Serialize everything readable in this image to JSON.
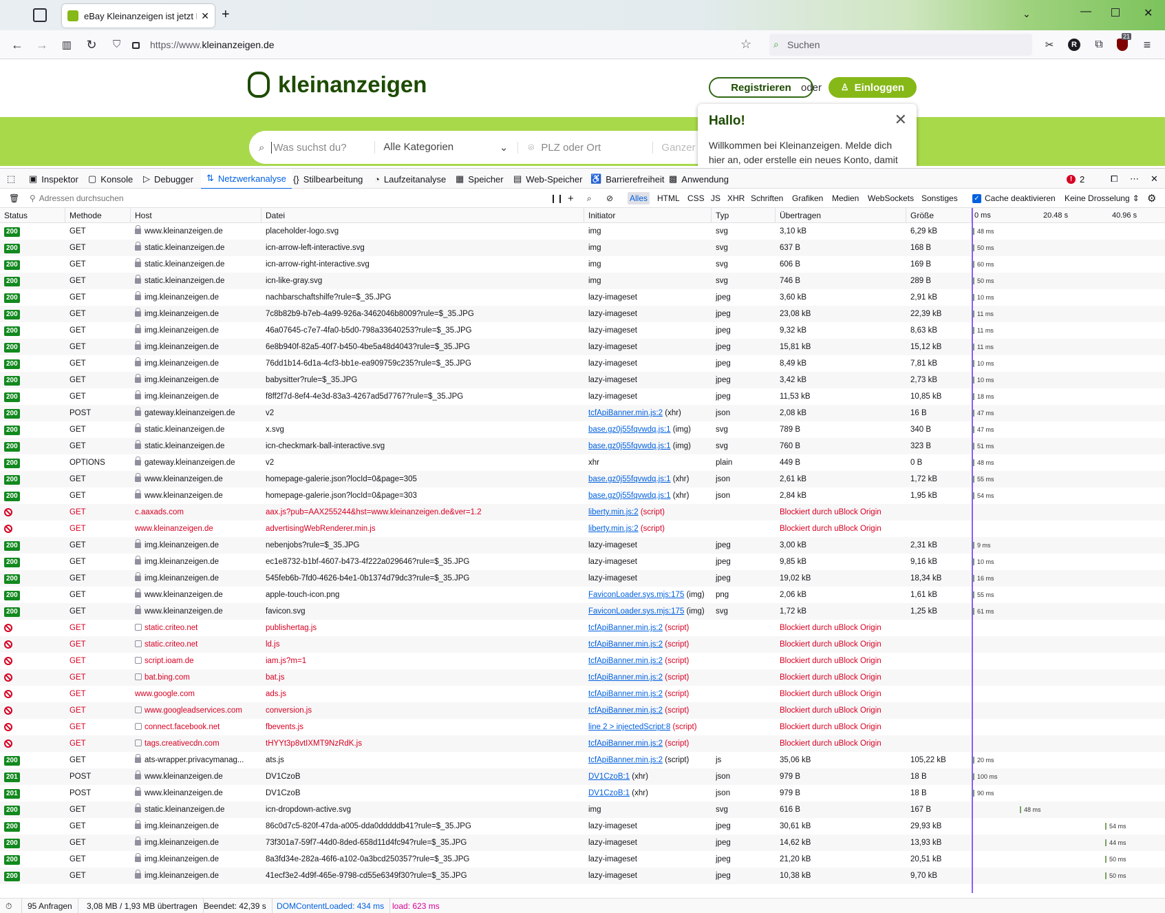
{
  "browser": {
    "tab_title": "eBay Kleinanzeigen ist jetzt Klein",
    "url_prefix": "https://www.",
    "url_domain": "kleinanzeigen.de",
    "search_placeholder": "Suchen",
    "profile_initial": "R",
    "ublock_badge": "21"
  },
  "page": {
    "logo_text": "kleinanzeigen",
    "register_label": "Registrieren",
    "or_label": "oder",
    "login_label": "Einloggen",
    "search_placeholder": "Was suchst du?",
    "category_label": "Alle Kategorien",
    "location_placeholder": "PLZ oder Ort",
    "radius_label": "Ganzer",
    "popup_title": "Hallo!",
    "popup_text": "Willkommen bei Kleinanzeigen. Melde dich hier an, oder erstelle ein neues Konto, damit"
  },
  "devtools": {
    "tabs": [
      "Inspektor",
      "Konsole",
      "Debugger",
      "Netzwerkanalyse",
      "Stilbearbeitung",
      "Laufzeitanalyse",
      "Speicher",
      "Web-Speicher",
      "Barrierefreiheit",
      "Anwendung"
    ],
    "selected_tab": "Netzwerkanalyse",
    "error_count": "2",
    "filter_placeholder": "Adressen durchsuchen",
    "type_filters": [
      "Alles",
      "HTML",
      "CSS",
      "JS",
      "XHR",
      "Schriften",
      "Grafiken",
      "Medien",
      "WebSockets",
      "Sonstiges"
    ],
    "selected_filter": "Alles",
    "cache_label": "Cache deaktivieren",
    "throttle_label": "Keine Drosselung",
    "columns": [
      "Status",
      "Methode",
      "Host",
      "Datei",
      "Initiator",
      "Typ",
      "Übertragen",
      "Größe"
    ],
    "waterfall_ticks": [
      "0 ms",
      "20.48 s",
      "40.96 s"
    ]
  },
  "requests": [
    {
      "status": "200",
      "method": "GET",
      "host": "www.kleinanzeigen.de",
      "file": "placeholder-logo.svg",
      "initiator": "img",
      "initiator_suffix": "",
      "type": "svg",
      "transferred": "3,10 kB",
      "size": "6,29 kB",
      "time": "48 ms",
      "blocked": false
    },
    {
      "status": "200",
      "method": "GET",
      "host": "static.kleinanzeigen.de",
      "file": "icn-arrow-left-interactive.svg",
      "initiator": "img",
      "initiator_suffix": "",
      "type": "svg",
      "transferred": "637 B",
      "size": "168 B",
      "time": "50 ms",
      "blocked": false
    },
    {
      "status": "200",
      "method": "GET",
      "host": "static.kleinanzeigen.de",
      "file": "icn-arrow-right-interactive.svg",
      "initiator": "img",
      "initiator_suffix": "",
      "type": "svg",
      "transferred": "606 B",
      "size": "169 B",
      "time": "60 ms",
      "blocked": false
    },
    {
      "status": "200",
      "method": "GET",
      "host": "static.kleinanzeigen.de",
      "file": "icn-like-gray.svg",
      "initiator": "img",
      "initiator_suffix": "",
      "type": "svg",
      "transferred": "746 B",
      "size": "289 B",
      "time": "50 ms",
      "blocked": false
    },
    {
      "status": "200",
      "method": "GET",
      "host": "img.kleinanzeigen.de",
      "file": "nachbarschaftshilfe?rule=$_35.JPG",
      "initiator": "lazy-imageset",
      "initiator_suffix": "",
      "type": "jpeg",
      "transferred": "3,60 kB",
      "size": "2,91 kB",
      "time": "10 ms",
      "blocked": false
    },
    {
      "status": "200",
      "method": "GET",
      "host": "img.kleinanzeigen.de",
      "file": "7c8b82b9-b7eb-4a99-926a-3462046b8009?rule=$_35.JPG",
      "initiator": "lazy-imageset",
      "initiator_suffix": "",
      "type": "jpeg",
      "transferred": "23,08 kB",
      "size": "22,39 kB",
      "time": "11 ms",
      "blocked": false
    },
    {
      "status": "200",
      "method": "GET",
      "host": "img.kleinanzeigen.de",
      "file": "46a07645-c7e7-4fa0-b5d0-798a33640253?rule=$_35.JPG",
      "initiator": "lazy-imageset",
      "initiator_suffix": "",
      "type": "jpeg",
      "transferred": "9,32 kB",
      "size": "8,63 kB",
      "time": "11 ms",
      "blocked": false
    },
    {
      "status": "200",
      "method": "GET",
      "host": "img.kleinanzeigen.de",
      "file": "6e8b940f-82a5-40f7-b450-4be5a48d4043?rule=$_35.JPG",
      "initiator": "lazy-imageset",
      "initiator_suffix": "",
      "type": "jpeg",
      "transferred": "15,81 kB",
      "size": "15,12 kB",
      "time": "11 ms",
      "blocked": false
    },
    {
      "status": "200",
      "method": "GET",
      "host": "img.kleinanzeigen.de",
      "file": "76dd1b14-6d1a-4cf3-bb1e-ea909759c235?rule=$_35.JPG",
      "initiator": "lazy-imageset",
      "initiator_suffix": "",
      "type": "jpeg",
      "transferred": "8,49 kB",
      "size": "7,81 kB",
      "time": "10 ms",
      "blocked": false
    },
    {
      "status": "200",
      "method": "GET",
      "host": "img.kleinanzeigen.de",
      "file": "babysitter?rule=$_35.JPG",
      "initiator": "lazy-imageset",
      "initiator_suffix": "",
      "type": "jpeg",
      "transferred": "3,42 kB",
      "size": "2,73 kB",
      "time": "10 ms",
      "blocked": false
    },
    {
      "status": "200",
      "method": "GET",
      "host": "img.kleinanzeigen.de",
      "file": "f8ff2f7d-8ef4-4e3d-83a3-4267ad5d7767?rule=$_35.JPG",
      "initiator": "lazy-imageset",
      "initiator_suffix": "",
      "type": "jpeg",
      "transferred": "11,53 kB",
      "size": "10,85 kB",
      "time": "18 ms",
      "blocked": false
    },
    {
      "status": "200",
      "method": "POST",
      "host": "gateway.kleinanzeigen.de",
      "file": "v2",
      "initiator": "tcfApiBanner.min.js:2",
      "initiator_suffix": "(xhr)",
      "type": "json",
      "transferred": "2,08 kB",
      "size": "16 B",
      "time": "47 ms",
      "blocked": false
    },
    {
      "status": "200",
      "method": "GET",
      "host": "static.kleinanzeigen.de",
      "file": "x.svg",
      "initiator": "base.gz0j55fqvwdq.js:1",
      "initiator_suffix": "(img)",
      "type": "svg",
      "transferred": "789 B",
      "size": "340 B",
      "time": "47 ms",
      "blocked": false
    },
    {
      "status": "200",
      "method": "GET",
      "host": "static.kleinanzeigen.de",
      "file": "icn-checkmark-ball-interactive.svg",
      "initiator": "base.gz0j55fqvwdq.js:1",
      "initiator_suffix": "(img)",
      "type": "svg",
      "transferred": "760 B",
      "size": "323 B",
      "time": "51 ms",
      "blocked": false
    },
    {
      "status": "200",
      "method": "OPTIONS",
      "host": "gateway.kleinanzeigen.de",
      "file": "v2",
      "initiator": "xhr",
      "initiator_suffix": "",
      "type": "plain",
      "transferred": "449 B",
      "size": "0 B",
      "time": "48 ms",
      "blocked": false
    },
    {
      "status": "200",
      "method": "GET",
      "host": "www.kleinanzeigen.de",
      "file": "homepage-galerie.json?locId=0&page=305",
      "initiator": "base.gz0j55fqvwdq.js:1",
      "initiator_suffix": "(xhr)",
      "type": "json",
      "transferred": "2,61 kB",
      "size": "1,72 kB",
      "time": "55 ms",
      "blocked": false
    },
    {
      "status": "200",
      "method": "GET",
      "host": "www.kleinanzeigen.de",
      "file": "homepage-galerie.json?locId=0&page=303",
      "initiator": "base.gz0j55fqvwdq.js:1",
      "initiator_suffix": "(xhr)",
      "type": "json",
      "transferred": "2,84 kB",
      "size": "1,95 kB",
      "time": "54 ms",
      "blocked": false
    },
    {
      "status": "",
      "method": "GET",
      "host": "c.aaxads.com",
      "file": "aax.js?pub=AAX255244&hst=www.kleinanzeigen.de&ver=1.2",
      "initiator": "liberty.min.js:2",
      "initiator_suffix": "(script)",
      "type": "",
      "transferred": "Blockiert durch uBlock Origin",
      "size": "",
      "time": "",
      "blocked": true
    },
    {
      "status": "",
      "method": "GET",
      "host": "www.kleinanzeigen.de",
      "file": "advertisingWebRenderer.min.js",
      "initiator": "liberty.min.js:2",
      "initiator_suffix": "(script)",
      "type": "",
      "transferred": "Blockiert durch uBlock Origin",
      "size": "",
      "time": "",
      "blocked": true
    },
    {
      "status": "200",
      "method": "GET",
      "host": "img.kleinanzeigen.de",
      "file": "nebenjobs?rule=$_35.JPG",
      "initiator": "lazy-imageset",
      "initiator_suffix": "",
      "type": "jpeg",
      "transferred": "3,00 kB",
      "size": "2,31 kB",
      "time": "9 ms",
      "blocked": false
    },
    {
      "status": "200",
      "method": "GET",
      "host": "img.kleinanzeigen.de",
      "file": "ec1e8732-b1bf-4607-b473-4f222a029646?rule=$_35.JPG",
      "initiator": "lazy-imageset",
      "initiator_suffix": "",
      "type": "jpeg",
      "transferred": "9,85 kB",
      "size": "9,16 kB",
      "time": "10 ms",
      "blocked": false
    },
    {
      "status": "200",
      "method": "GET",
      "host": "img.kleinanzeigen.de",
      "file": "545feb6b-7fd0-4626-b4e1-0b1374d79dc3?rule=$_35.JPG",
      "initiator": "lazy-imageset",
      "initiator_suffix": "",
      "type": "jpeg",
      "transferred": "19,02 kB",
      "size": "18,34 kB",
      "time": "16 ms",
      "blocked": false
    },
    {
      "status": "200",
      "method": "GET",
      "host": "www.kleinanzeigen.de",
      "file": "apple-touch-icon.png",
      "initiator": "FaviconLoader.sys.mjs:175",
      "initiator_suffix": "(img)",
      "type": "png",
      "transferred": "2,06 kB",
      "size": "1,61 kB",
      "time": "55 ms",
      "blocked": false
    },
    {
      "status": "200",
      "method": "GET",
      "host": "www.kleinanzeigen.de",
      "file": "favicon.svg",
      "initiator": "FaviconLoader.sys.mjs:175",
      "initiator_suffix": "(img)",
      "type": "svg",
      "transferred": "1,72 kB",
      "size": "1,25 kB",
      "time": "61 ms",
      "blocked": false
    },
    {
      "status": "",
      "method": "GET",
      "host": "static.criteo.net",
      "file": "publishertag.js",
      "initiator": "tcfApiBanner.min.js:2",
      "initiator_suffix": "(script)",
      "type": "",
      "transferred": "Blockiert durch uBlock Origin",
      "size": "",
      "time": "",
      "blocked": true
    },
    {
      "status": "",
      "method": "GET",
      "host": "static.criteo.net",
      "file": "ld.js",
      "initiator": "tcfApiBanner.min.js:2",
      "initiator_suffix": "(script)",
      "type": "",
      "transferred": "Blockiert durch uBlock Origin",
      "size": "",
      "time": "",
      "blocked": true
    },
    {
      "status": "",
      "method": "GET",
      "host": "script.ioam.de",
      "file": "iam.js?m=1",
      "initiator": "tcfApiBanner.min.js:2",
      "initiator_suffix": "(script)",
      "type": "",
      "transferred": "Blockiert durch uBlock Origin",
      "size": "",
      "time": "",
      "blocked": true
    },
    {
      "status": "",
      "method": "GET",
      "host": "bat.bing.com",
      "file": "bat.js",
      "initiator": "tcfApiBanner.min.js:2",
      "initiator_suffix": "(script)",
      "type": "",
      "transferred": "Blockiert durch uBlock Origin",
      "size": "",
      "time": "",
      "blocked": true
    },
    {
      "status": "",
      "method": "GET",
      "host": "www.google.com",
      "file": "ads.js",
      "initiator": "tcfApiBanner.min.js:2",
      "initiator_suffix": "(script)",
      "type": "",
      "transferred": "Blockiert durch uBlock Origin",
      "size": "",
      "time": "",
      "blocked": true
    },
    {
      "status": "",
      "method": "GET",
      "host": "www.googleadservices.com",
      "file": "conversion.js",
      "initiator": "tcfApiBanner.min.js:2",
      "initiator_suffix": "(script)",
      "type": "",
      "transferred": "Blockiert durch uBlock Origin",
      "size": "",
      "time": "",
      "blocked": true
    },
    {
      "status": "",
      "method": "GET",
      "host": "connect.facebook.net",
      "file": "fbevents.js",
      "initiator": "line 2 > injectedScript:8",
      "initiator_suffix": "(script)",
      "type": "",
      "transferred": "Blockiert durch uBlock Origin",
      "size": "",
      "time": "",
      "blocked": true
    },
    {
      "status": "",
      "method": "GET",
      "host": "tags.creativecdn.com",
      "file": "tHYYt3p8vtIXMT9NzRdK.js",
      "initiator": "tcfApiBanner.min.js:2",
      "initiator_suffix": "(script)",
      "type": "",
      "transferred": "Blockiert durch uBlock Origin",
      "size": "",
      "time": "",
      "blocked": true
    },
    {
      "status": "200",
      "method": "GET",
      "host": "ats-wrapper.privacymanag...",
      "file": "ats.js",
      "initiator": "tcfApiBanner.min.js:2",
      "initiator_suffix": "(script)",
      "type": "js",
      "transferred": "35,06 kB",
      "size": "105,22 kB",
      "time": "20 ms",
      "blocked": false
    },
    {
      "status": "201",
      "method": "POST",
      "host": "www.kleinanzeigen.de",
      "file": "DV1CzoB",
      "initiator": "DV1CzoB:1",
      "initiator_suffix": "(xhr)",
      "type": "json",
      "transferred": "979 B",
      "size": "18 B",
      "time": "100 ms",
      "blocked": false
    },
    {
      "status": "201",
      "method": "POST",
      "host": "www.kleinanzeigen.de",
      "file": "DV1CzoB",
      "initiator": "DV1CzoB:1",
      "initiator_suffix": "(xhr)",
      "type": "json",
      "transferred": "979 B",
      "size": "18 B",
      "time": "90 ms",
      "blocked": false
    },
    {
      "status": "200",
      "method": "GET",
      "host": "static.kleinanzeigen.de",
      "file": "icn-dropdown-active.svg",
      "initiator": "img",
      "initiator_suffix": "",
      "type": "svg",
      "transferred": "616 B",
      "size": "167 B",
      "time": "48 ms",
      "blocked": false
    },
    {
      "status": "200",
      "method": "GET",
      "host": "img.kleinanzeigen.de",
      "file": "86c0d7c5-820f-47da-a005-dda0dddddb41?rule=$_35.JPG",
      "initiator": "lazy-imageset",
      "initiator_suffix": "",
      "type": "jpeg",
      "transferred": "30,61 kB",
      "size": "29,93 kB",
      "time": "54 ms",
      "blocked": false
    },
    {
      "status": "200",
      "method": "GET",
      "host": "img.kleinanzeigen.de",
      "file": "73f301a7-59f7-44d0-8ded-658d11d4fc94?rule=$_35.JPG",
      "initiator": "lazy-imageset",
      "initiator_suffix": "",
      "type": "jpeg",
      "transferred": "14,62 kB",
      "size": "13,93 kB",
      "time": "44 ms",
      "blocked": false
    },
    {
      "status": "200",
      "method": "GET",
      "host": "img.kleinanzeigen.de",
      "file": "8a3fd34e-282a-46f6-a102-0a3bcd250357?rule=$_35.JPG",
      "initiator": "lazy-imageset",
      "initiator_suffix": "",
      "type": "jpeg",
      "transferred": "21,20 kB",
      "size": "20,51 kB",
      "time": "50 ms",
      "blocked": false
    },
    {
      "status": "200",
      "method": "GET",
      "host": "img.kleinanzeigen.de",
      "file": "41ecf3e2-4d9f-465e-9798-cd55e6349f30?rule=$_35.JPG",
      "initiator": "lazy-imageset",
      "initiator_suffix": "",
      "type": "jpeg",
      "transferred": "10,38 kB",
      "size": "9,70 kB",
      "time": "50 ms",
      "blocked": false
    }
  ],
  "statusbar": {
    "requests": "95 Anfragen",
    "transferred": "3,08 MB / 1,93 MB übertragen",
    "finished": "Beendet: 42,39 s",
    "dom": "DOMContentLoaded: 434 ms",
    "load": "load: 623 ms"
  }
}
